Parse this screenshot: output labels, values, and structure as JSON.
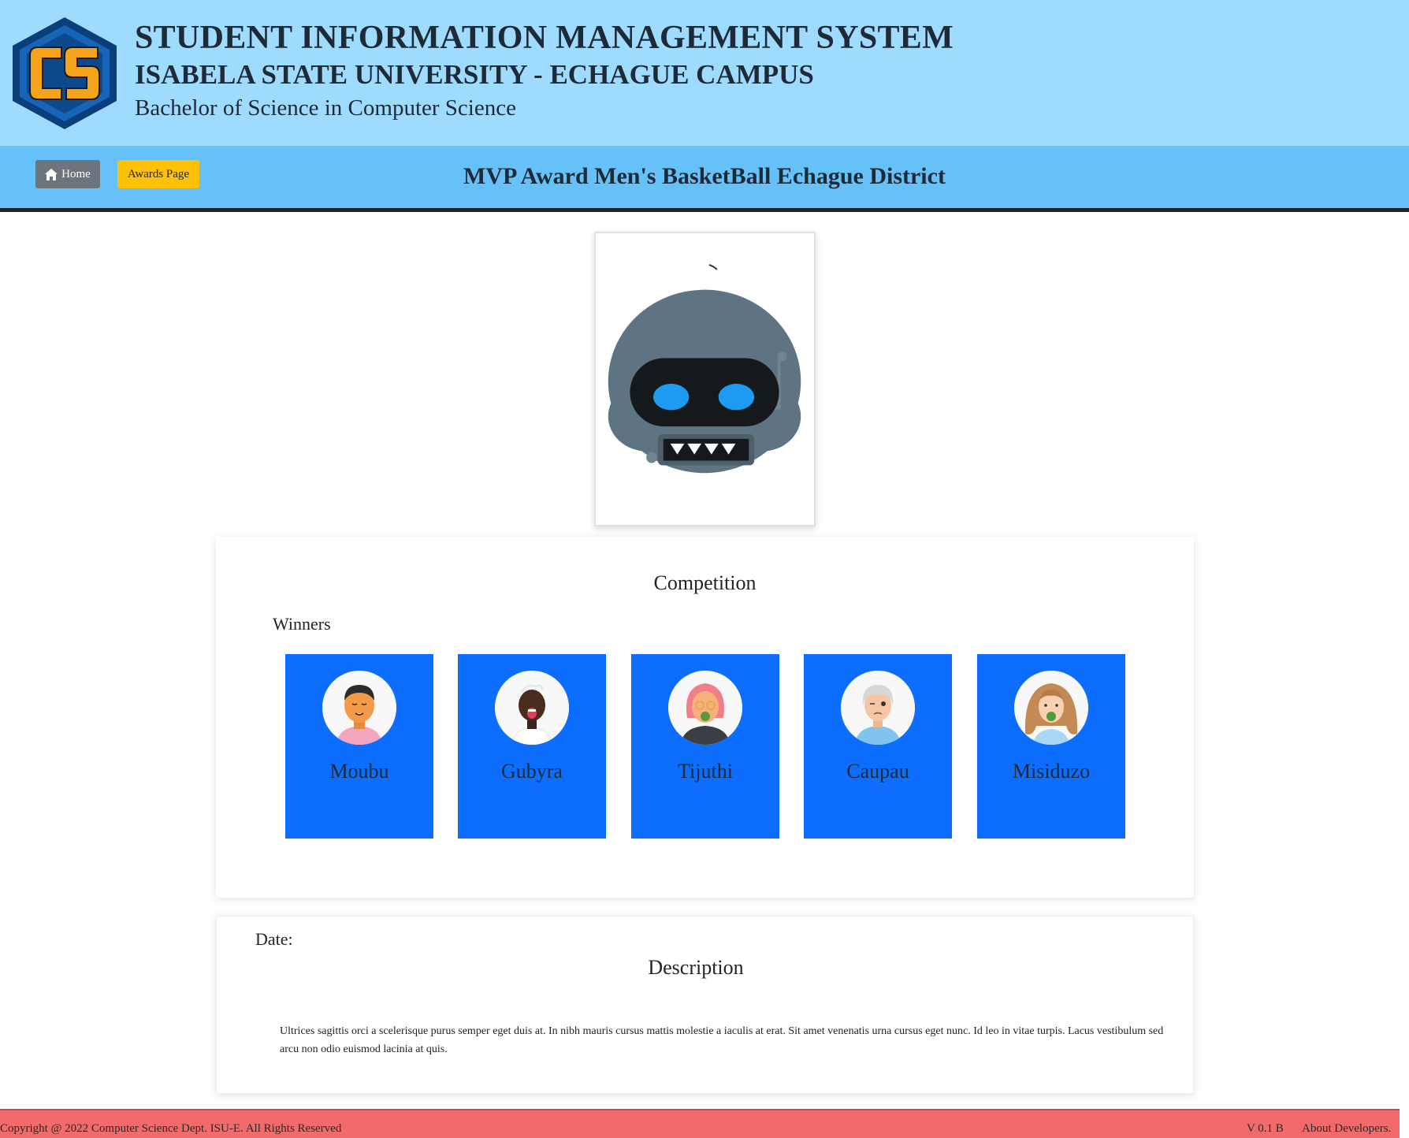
{
  "header": {
    "logo_text": "CS",
    "title": "STUDENT INFORMATION MANAGEMENT SYSTEM",
    "university": "ISABELA STATE UNIVERSITY - ECHAGUE CAMPUS",
    "program": "Bachelor of Science in Computer Science"
  },
  "navbar": {
    "home_label": "Home",
    "awards_label": "Awards Page",
    "page_title": "MVP Award Men's BasketBall Echague District"
  },
  "competition": {
    "title": "Competition",
    "winners_label": "Winners",
    "winners": [
      {
        "name": "Moubu",
        "avatar": "man-avatar"
      },
      {
        "name": "Gubyra",
        "avatar": "dark-skin-avatar"
      },
      {
        "name": "Tijuthi",
        "avatar": "pink-hair-avatar"
      },
      {
        "name": "Caupau",
        "avatar": "elder-avatar"
      },
      {
        "name": "Misiduzo",
        "avatar": "woman-avatar"
      }
    ]
  },
  "details": {
    "date_label": "Date:",
    "description_title": "Description",
    "description_text": "Ultrices sagittis orci a scelerisque purus semper eget duis at. In nibh mauris cursus mattis molestie a iaculis at erat. Sit amet venenatis urna cursus eget nunc. Id leo in vitae turpis. Lacus vestibulum sed arcu non odio euismod lacinia at quis."
  },
  "footer": {
    "copyright": "Copyright @ 2022 Computer Science Dept. ISU-E. All Rights Reserved",
    "version": "V 0.1 B",
    "about": "About Developers."
  },
  "colors": {
    "header_bg": "#9fdbff",
    "navbar_bg": "#66c1f8",
    "winner_card": "#0d6efd",
    "home_button": "#6c757d",
    "awards_button": "#ffc107",
    "footer_bg": "#f16b6b"
  }
}
